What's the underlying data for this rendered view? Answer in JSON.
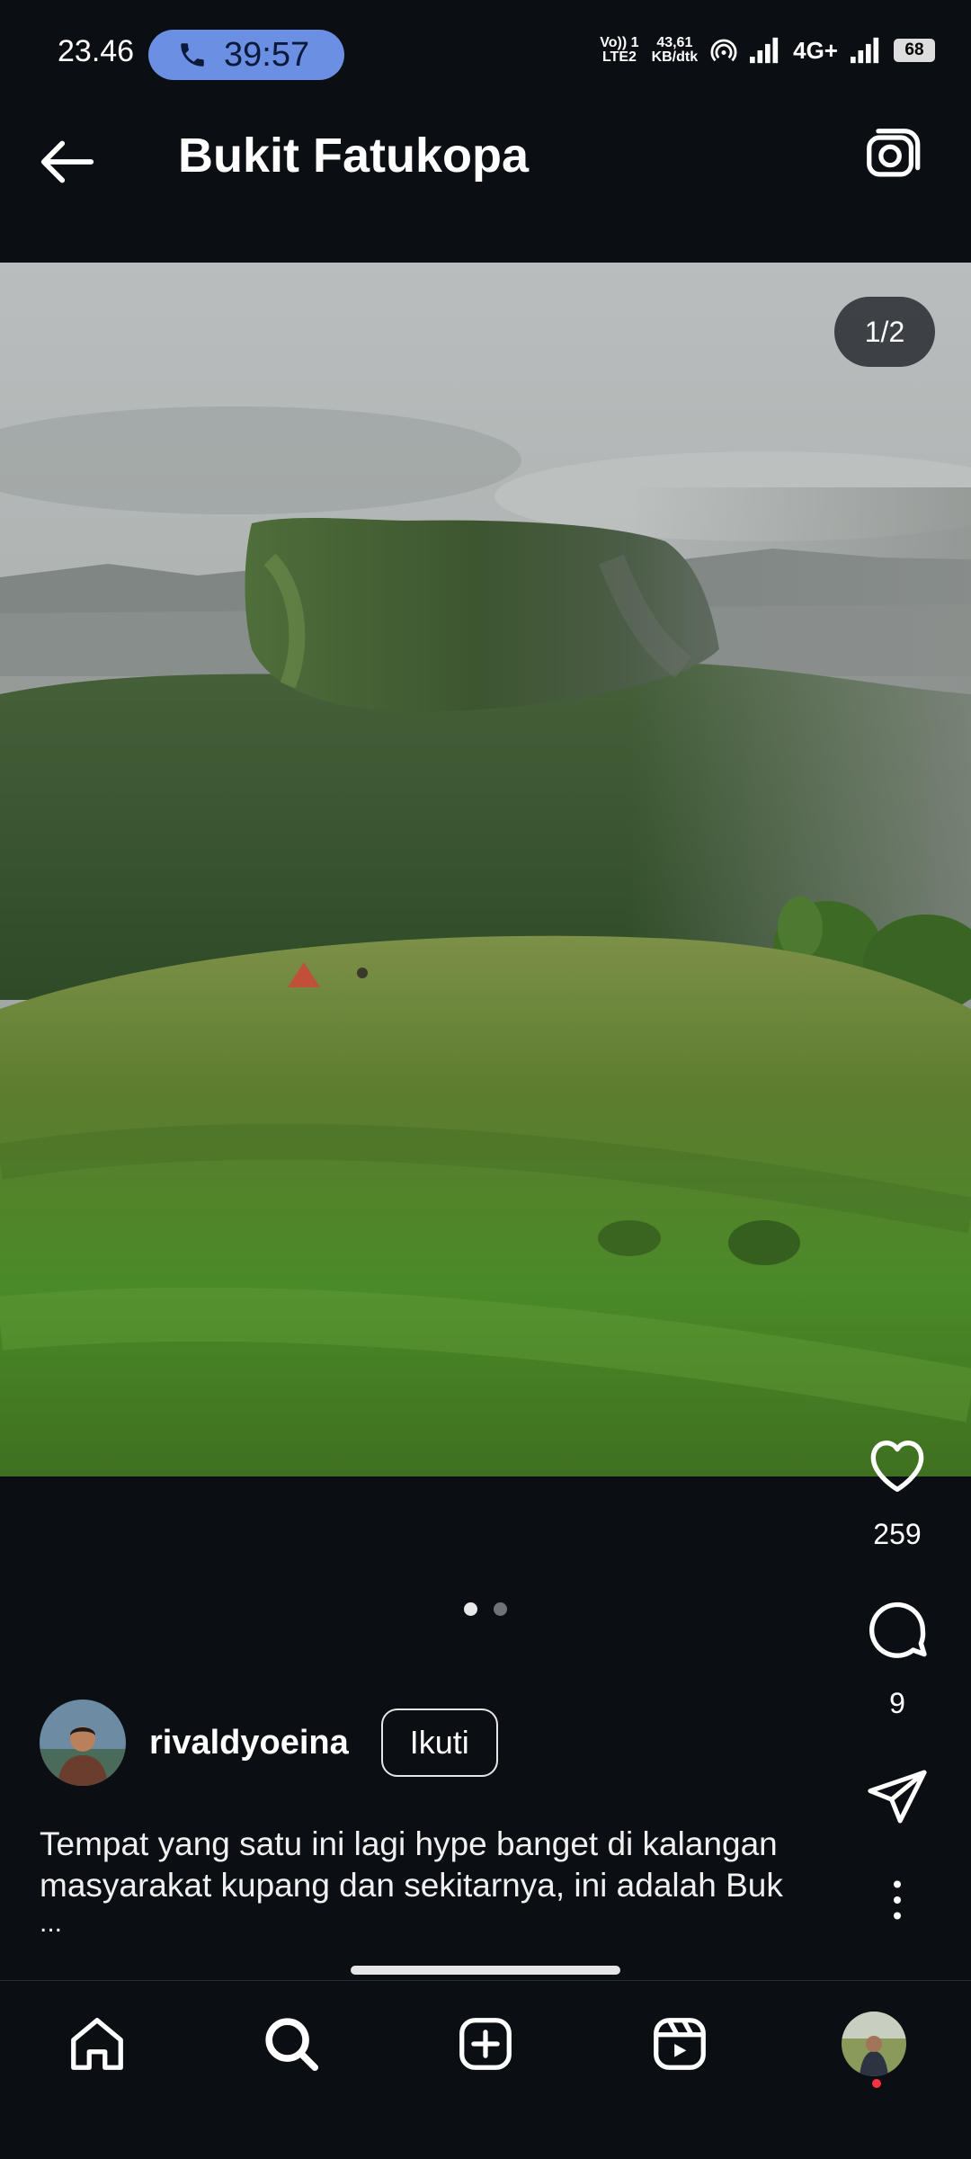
{
  "status_bar": {
    "time": "23.46",
    "call_duration": "39:57",
    "volte_line1": "Vo)) 1",
    "volte_line2": "LTE2",
    "speed_value": "43,61",
    "speed_unit": "KB/dtk",
    "network": "4G+",
    "battery": "68"
  },
  "header": {
    "title": "Bukit Fatukopa"
  },
  "post": {
    "page_counter": "1/2",
    "slide_count": 2,
    "active_slide": 1,
    "likes": "259",
    "comments": "9",
    "username": "rivaldyoeina",
    "follow_label": "Ikuti",
    "caption_line1": "Tempat yang satu ini lagi hype banget di kalangan",
    "caption_line2": "masyarakat kupang dan sekitarnya, ini adalah Buk",
    "caption_more": "..."
  },
  "icons": {
    "back": "arrow-left-icon",
    "camera": "camera-icon",
    "like": "heart-icon",
    "comment": "comment-icon",
    "share": "paper-plane-icon",
    "more": "more-vertical-icon",
    "nav": [
      "home-icon",
      "search-icon",
      "create-icon",
      "reels-icon",
      "profile-avatar"
    ]
  },
  "colors": {
    "background": "#0b0f14",
    "call_pill": "#6b8fe3",
    "notification_dot": "#ff3040"
  }
}
